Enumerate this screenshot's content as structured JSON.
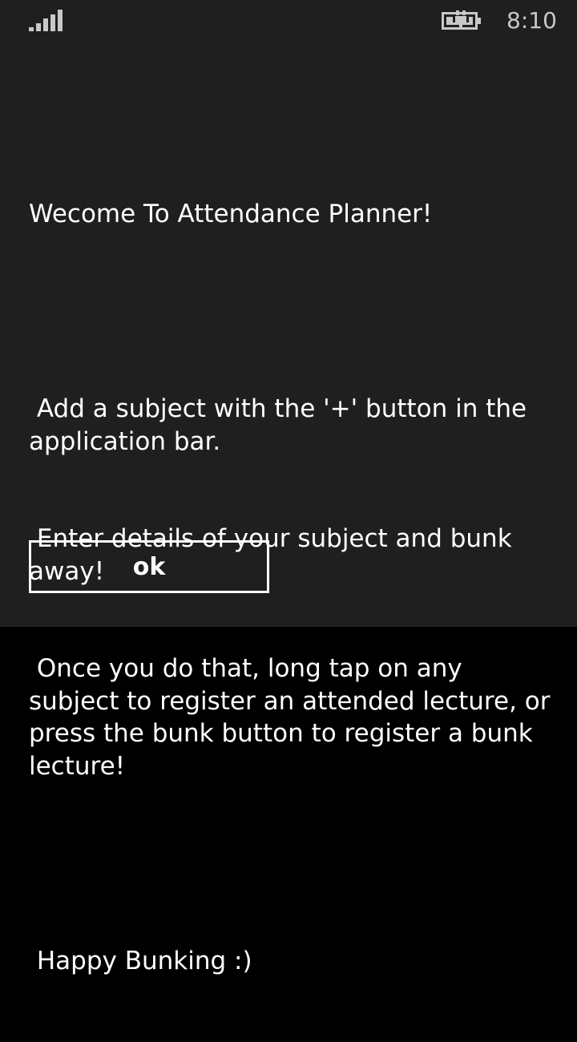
{
  "status_bar": {
    "time": "8:10",
    "signal_icon": "signal-bars-icon",
    "battery_icon": "battery-charging-icon"
  },
  "dialog": {
    "title": "Wecome To Attendance Planner!",
    "line1": " Add a subject with the '+' button in the application bar.",
    "line2": " Enter details of your subject and bunk away!",
    "line3": " Once you do that, long tap on any subject to register an attended lecture, or press the bunk button to register a bunk lecture!",
    "line4": " Happy Bunking :)",
    "ok_label": "ok"
  },
  "colors": {
    "dialog_background": "#1f1f1f",
    "page_background": "#000000",
    "text": "#ffffff"
  }
}
